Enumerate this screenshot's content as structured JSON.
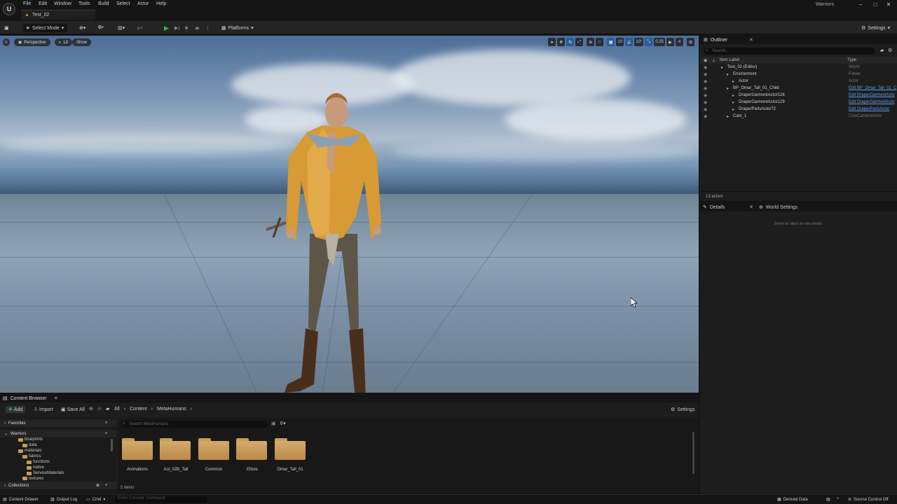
{
  "app": {
    "menu": [
      "File",
      "Edit",
      "Window",
      "Tools",
      "Build",
      "Select",
      "Actor",
      "Help"
    ],
    "project_name": "Warriors",
    "level_tab": "Test_02"
  },
  "toolbar": {
    "mode": "Select Mode",
    "platforms": "Platforms",
    "settings": "Settings"
  },
  "viewport": {
    "perspective": "Perspective",
    "lit": "Lit",
    "show": "Show",
    "grid_snap": "10",
    "rotation_snap": "10°",
    "scale_snap": "0.25",
    "camera_speed": "4"
  },
  "outliner": {
    "tab": "Outliner",
    "search_placeholder": "Search...",
    "col_label": "Item Label",
    "col_type": "Type",
    "rows": [
      {
        "label": "Test_02 (Editor)",
        "type": "World",
        "link": false
      },
      {
        "label": "Environment",
        "type": "Folder",
        "link": false
      },
      {
        "label": "Actor",
        "type": "Actor",
        "link": false
      },
      {
        "label": "BP_Omar_Tall_01_Child",
        "type": "Edit BP_Omar_Tall_01_C",
        "link": true
      },
      {
        "label": "DraperGarmentActor128",
        "type": "Edit DraperGarmentActo",
        "link": true
      },
      {
        "label": "DraperGarmentActor129",
        "type": "Edit DraperGarmentActo",
        "link": true
      },
      {
        "label": "DraperPartsActor72",
        "type": "Edit DraperPartsActor",
        "link": true
      },
      {
        "label": "Cam_1",
        "type": "CineCameraActor",
        "link": false
      }
    ],
    "footer": "13 actors"
  },
  "details": {
    "tab_details": "Details",
    "tab_world": "World Settings",
    "empty_message": "Select an object to view details."
  },
  "content_browser": {
    "tab": "Content Browser",
    "add": "Add",
    "import": "Import",
    "save_all": "Save All",
    "breadcrumb": [
      "All",
      "Content",
      "MetaHumans"
    ],
    "settings": "Settings",
    "favorites": "Favorites",
    "project": "Warriors",
    "collections": "Collections",
    "tree": [
      "blueprints",
      "data",
      "materials",
      "fabrics",
      "functions",
      "native",
      "ServiceMaterials",
      "textures"
    ],
    "search_placeholder": "Search MetaHumans",
    "folders": [
      "Animations",
      "Aoi_02B_Tall",
      "Common",
      "Ettore",
      "Omar_Tall_01"
    ],
    "item_count": "5 items"
  },
  "status": {
    "content_drawer": "Content Drawer",
    "output_log": "Output Log",
    "cmd": "Cmd",
    "console_placeholder": "Enter Console Command",
    "derived_data": "Derived Data",
    "source_control": "Source Control Off"
  },
  "colors": {
    "accent": "#2b5c9a",
    "play_green": "#39b54a",
    "link_blue": "#5c9ee8",
    "folder": "#c89a52"
  }
}
